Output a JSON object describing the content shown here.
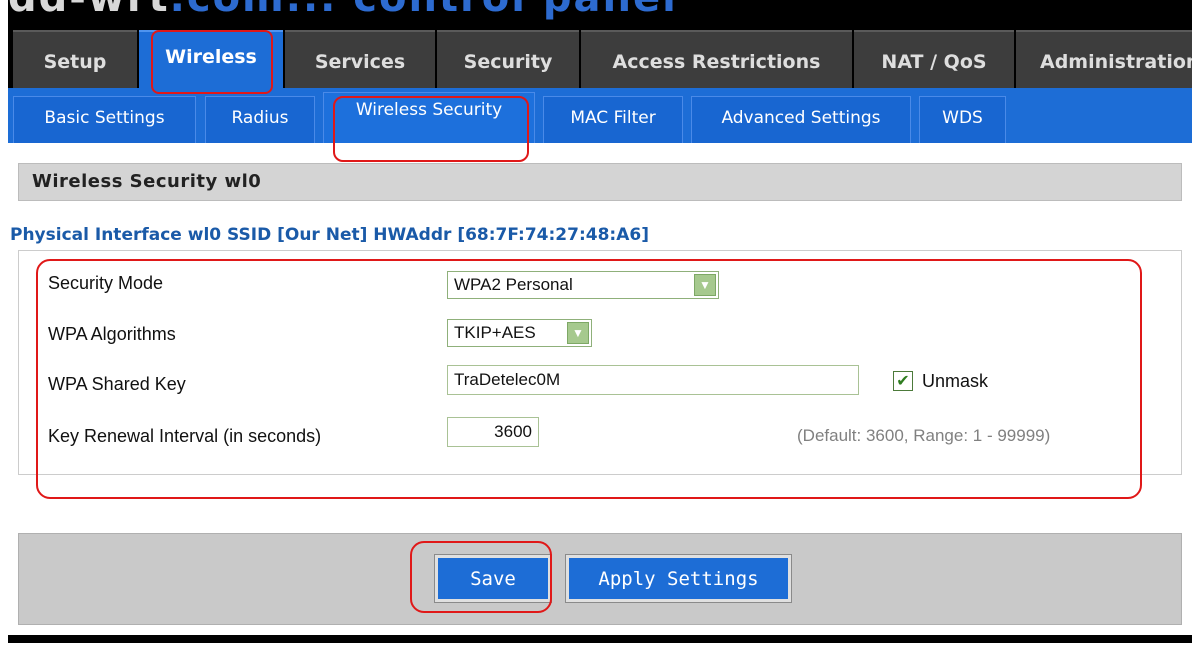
{
  "logo": {
    "part1": "dd-wrt",
    "part2": ".com",
    "part3": "... control panel"
  },
  "main_tabs": [
    {
      "label": "Setup"
    },
    {
      "label": "Wireless"
    },
    {
      "label": "Services"
    },
    {
      "label": "Security"
    },
    {
      "label": "Access Restrictions"
    },
    {
      "label": "NAT / QoS"
    },
    {
      "label": "Administration"
    }
  ],
  "sub_tabs": [
    {
      "label": "Basic Settings"
    },
    {
      "label": "Radius"
    },
    {
      "label": "Wireless Security"
    },
    {
      "label": "MAC Filter"
    },
    {
      "label": "Advanced Settings"
    },
    {
      "label": "WDS"
    }
  ],
  "section": {
    "title": "Wireless Security wl0",
    "interface_title": "Physical Interface wl0 SSID [Our Net] HWAddr [68:7F:74:27:48:A6]"
  },
  "fields": {
    "security_mode": {
      "label": "Security Mode",
      "value": "WPA2 Personal"
    },
    "wpa_algorithms": {
      "label": "WPA Algorithms",
      "value": "TKIP+AES"
    },
    "wpa_shared_key": {
      "label": "WPA Shared Key",
      "value": "TraDetelec0M"
    },
    "unmask": {
      "label": "Unmask",
      "checked": true
    },
    "key_renewal": {
      "label": "Key Renewal Interval (in seconds)",
      "value": "3600",
      "hint": "(Default: 3600, Range: 1 - 99999)"
    }
  },
  "buttons": {
    "save": "Save",
    "apply": "Apply Settings"
  },
  "colors": {
    "accent": "#1d6dd6",
    "highlight": "#e01818",
    "check": "#2f7d20"
  }
}
